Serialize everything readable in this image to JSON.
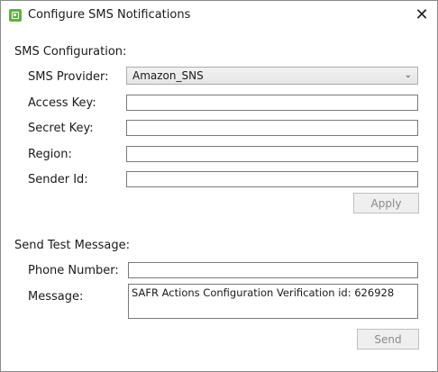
{
  "window": {
    "title": "Configure SMS Notifications",
    "close_glyph": "✕",
    "app_icon": "sms-app-icon"
  },
  "sms_config": {
    "section_label": "SMS Configuration:",
    "provider_label": "SMS Provider:",
    "provider_value": "Amazon_SNS",
    "provider_chevron": "⌄",
    "access_key_label": "Access Key:",
    "access_key_value": "",
    "secret_key_label": "Secret Key:",
    "secret_key_value": "",
    "region_label": "Region:",
    "region_value": "",
    "sender_id_label": "Sender Id:",
    "sender_id_value": "",
    "apply_label": "Apply"
  },
  "test_message": {
    "section_label": "Send Test Message:",
    "phone_label": "Phone Number:",
    "phone_value": "",
    "message_label": "Message:",
    "message_value": "SAFR Actions Configuration Verification id: 626928",
    "send_label": "Send"
  },
  "colors": {
    "app_icon": "#5fb041",
    "disabled_button_text": "#8a8a8a",
    "input_border": "#7a7a7a"
  }
}
